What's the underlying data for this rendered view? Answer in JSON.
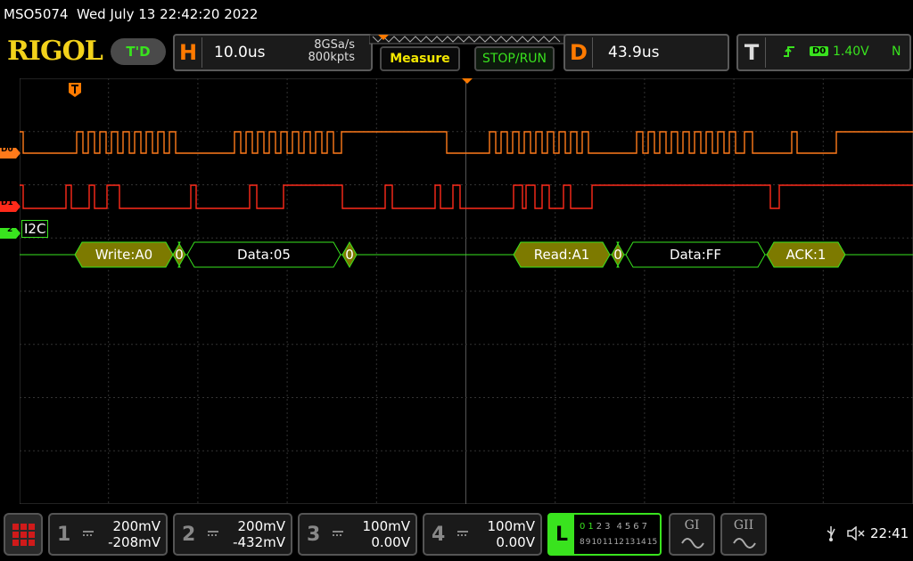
{
  "header": {
    "model": "MSO5074",
    "datetime": "Wed July 13 22:42:20 2022",
    "brand": "RIGOL",
    "td_label": "T'D"
  },
  "horizontal": {
    "letter": "H",
    "timebase": "10.0us",
    "sample_rate": "8GSa/s",
    "memory_depth": "800kpts"
  },
  "buttons": {
    "measure": "Measure",
    "stop_run": "STOP/RUN"
  },
  "delay": {
    "letter": "D",
    "value": "43.9us"
  },
  "trigger": {
    "letter": "T",
    "source": "D0",
    "level": "1.40V",
    "mode": "N"
  },
  "waveform": {
    "d0_label": "D0",
    "d1_label": "D1",
    "bus_marker": "2",
    "bus_name": "I2C",
    "decode_fields": [
      {
        "text": "Write:A0",
        "kind": "addr"
      },
      {
        "text": "0",
        "kind": "ack"
      },
      {
        "text": "Data:05",
        "kind": "data"
      },
      {
        "text": "0",
        "kind": "ack"
      },
      {
        "text": "Read:A1",
        "kind": "addr"
      },
      {
        "text": "0",
        "kind": "ack"
      },
      {
        "text": "Data:FF",
        "kind": "data"
      },
      {
        "text": "ACK:1",
        "kind": "addr"
      }
    ]
  },
  "channels": [
    {
      "num": "1",
      "scale": "200mV",
      "offset": "-208mV"
    },
    {
      "num": "2",
      "scale": "200mV",
      "offset": "-432mV"
    },
    {
      "num": "3",
      "scale": "100mV",
      "offset": "0.00V"
    },
    {
      "num": "4",
      "scale": "100mV",
      "offset": "0.00V"
    }
  ],
  "logic": {
    "letter": "L",
    "row1": [
      "0",
      "1",
      "2",
      "3",
      "4",
      "5",
      "6",
      "7"
    ],
    "row2": [
      "8",
      "9",
      "10",
      "11",
      "12",
      "13",
      "14",
      "15"
    ]
  },
  "generators": [
    "GI",
    "GII"
  ],
  "status": {
    "time": "22:41"
  },
  "colors": {
    "d0": "#ff7a1a",
    "d1": "#ff2a1a",
    "bus": "#39e31e",
    "decode_fill": "#7d7a00",
    "accent_orange": "#ff7a00"
  }
}
